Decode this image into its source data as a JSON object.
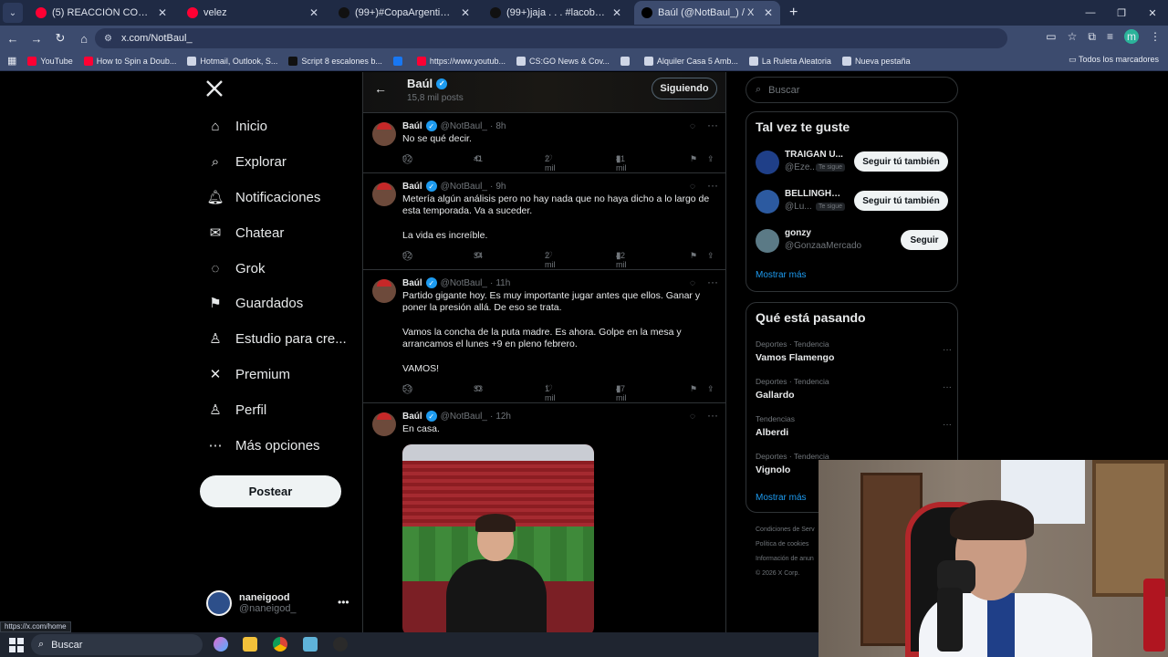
{
  "browser": {
    "tabs": [
      {
        "title": "(5) REACCIÓN CON LOS HINCH",
        "color": "#ff0033",
        "active": false
      },
      {
        "title": "velez",
        "color": "#ff0033",
        "active": false
      },
      {
        "title": "(99+)#CopaArgentina 2013 #Ju",
        "color": "#111111",
        "active": false
      },
      {
        "title": "(99+)jaja . . . #lacobra #lacobra",
        "color": "#111111",
        "active": false
      },
      {
        "title": "Baúl (@NotBaul_) / X",
        "color": "#000000",
        "active": true
      }
    ],
    "address": "x.com/NotBaul_",
    "bookmarks": [
      {
        "label": "YouTube",
        "color": "#ff0033"
      },
      {
        "label": "How to Spin a Doub...",
        "color": "#ff0033"
      },
      {
        "label": "Hotmail, Outlook, S...",
        "color": "#cfd6e6"
      },
      {
        "label": "Script 8 escalones b...",
        "color": "#111111"
      },
      {
        "label": "",
        "color": "#1877f2"
      },
      {
        "label": "https://www.youtub...",
        "color": "#ff0033"
      },
      {
        "label": "CS:GO News & Cov...",
        "color": "#cfd6e6"
      },
      {
        "label": "",
        "color": "#cfd6e6"
      },
      {
        "label": "Alquiler Casa 5 Amb...",
        "color": "#cfd6e6"
      },
      {
        "label": "La Ruleta Aleatoria",
        "color": "#cfd6e6"
      },
      {
        "label": "Nueva pestaña",
        "color": "#cfd6e6"
      }
    ],
    "all_bookmarks": "Todos los marcadores",
    "profile_initial": "m"
  },
  "nav": {
    "items": [
      {
        "label": "Inicio",
        "icon": "home-icon"
      },
      {
        "label": "Explorar",
        "icon": "search-icon"
      },
      {
        "label": "Notificaciones",
        "icon": "bell-icon"
      },
      {
        "label": "Chatear",
        "icon": "mail-icon"
      },
      {
        "label": "Grok",
        "icon": "grok-icon"
      },
      {
        "label": "Guardados",
        "icon": "bookmark-icon"
      },
      {
        "label": "Estudio para cre...",
        "icon": "studio-icon"
      },
      {
        "label": "Premium",
        "icon": "x-premium-icon"
      },
      {
        "label": "Perfil",
        "icon": "person-icon"
      },
      {
        "label": "Más opciones",
        "icon": "more-circle-icon"
      }
    ],
    "post_button": "Postear",
    "account": {
      "name": "naneigood",
      "handle": "@naneigod_"
    }
  },
  "profile": {
    "name": "Baúl",
    "posts": "15,8 mil posts",
    "follow_button": "Siguiendo"
  },
  "tweets": [
    {
      "name": "Baúl",
      "handle": "@NotBaul_",
      "time": "8h",
      "text": "No se qué decir.",
      "replies": "92",
      "reposts": "41",
      "likes": "2 mil",
      "views": "81 mil"
    },
    {
      "name": "Baúl",
      "handle": "@NotBaul_",
      "time": "9h",
      "text": "Metería algún análisis pero no hay nada que no haya dicho a lo largo de esta temporada. Va a suceder.\n\nLa vida es increíble.",
      "replies": "92",
      "reposts": "34",
      "likes": "2 mil",
      "views": "42 mil"
    },
    {
      "name": "Baúl",
      "handle": "@NotBaul_",
      "time": "11h",
      "text": "Partido gigante hoy. Es muy importante jugar antes que ellos. Ganar y poner la presión allá. De eso se trata.\n\nVamos la concha de la puta madre. Es ahora. Golpe en la mesa y arrancamos el lunes +9 en pleno febrero.\n\nVAMOS!",
      "replies": "53",
      "reposts": "33",
      "likes": "1 mil",
      "views": "47 mil"
    },
    {
      "name": "Baúl",
      "handle": "@NotBaul_",
      "time": "12h",
      "text": "En casa."
    }
  ],
  "right": {
    "search_placeholder": "Buscar",
    "who_title": "Tal vez te guste",
    "who": [
      {
        "name": "TRAIGAN U...",
        "handle": "@Eze...",
        "follows_you": "Te sigue",
        "button": "Seguir tú también"
      },
      {
        "name": "BELLINGHA...",
        "handle": "@Lu...",
        "follows_you": "Te sigue",
        "button": "Seguir tú también"
      },
      {
        "name": "gonzy",
        "handle": "@GonzaaMercado",
        "follows_you": "",
        "button": "Seguir"
      }
    ],
    "show_more": "Mostrar más",
    "trends_title": "Qué está pasando",
    "trends": [
      {
        "context": "Deportes · Tendencia",
        "name": "Vamos Flamengo"
      },
      {
        "context": "Deportes · Tendencia",
        "name": "Gallardo"
      },
      {
        "context": "Tendencias",
        "name": "Alberdi"
      },
      {
        "context": "Deportes · Tendencia",
        "name": "Vignolo"
      }
    ],
    "trends_show_more": "Mostrar más",
    "footer": [
      "Condiciones de Serv",
      "Política de cookies",
      "Información de anun",
      "© 2026 X Corp."
    ]
  },
  "status_url": "https://x.com/home",
  "taskbar": {
    "search": "Buscar"
  }
}
